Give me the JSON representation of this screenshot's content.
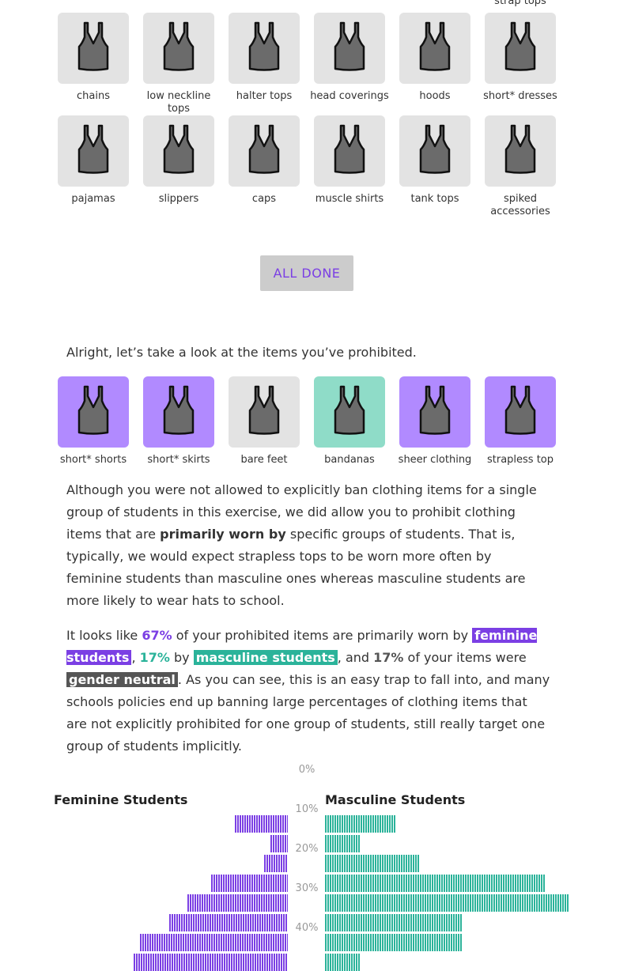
{
  "top_partial_label": "strap tops",
  "selection_grid": [
    {
      "label": "chains"
    },
    {
      "label": "low neckline tops"
    },
    {
      "label": "halter tops"
    },
    {
      "label": "head coverings"
    },
    {
      "label": "hoods"
    },
    {
      "label": "short* dresses"
    },
    {
      "label": "pajamas"
    },
    {
      "label": "slippers"
    },
    {
      "label": "caps"
    },
    {
      "label": "muscle shirts"
    },
    {
      "label": "tank tops"
    },
    {
      "label": "spiked accessories"
    }
  ],
  "done_button": "ALL DONE",
  "intro_text": "Alright, let’s take a look at the items you’ve prohibited.",
  "prohibited_items": [
    {
      "label": "short* shorts",
      "group": "feminine"
    },
    {
      "label": "short* skirts",
      "group": "feminine"
    },
    {
      "label": "bare feet",
      "group": "neutral"
    },
    {
      "label": "bandanas",
      "group": "masculine"
    },
    {
      "label": "sheer clothing",
      "group": "feminine"
    },
    {
      "label": "strapless top",
      "group": "feminine"
    }
  ],
  "explanation": {
    "part1": "Although you were not allowed to explicitly ban clothing items for a single group of students in this exercise, we did allow you to prohibit clothing items that are ",
    "bold": "primarily worn by",
    "part2": " specific groups of students. That is, typically, we would expect strapless tops to be worn more often by feminine students than masculine ones whereas masculine students are more likely to wear hats to school."
  },
  "summary": {
    "s1": "It looks like ",
    "fem_pct": "67%",
    "s2": " of your prohibited items are primarily worn by ",
    "fem_label": "feminine students",
    "s3": ", ",
    "masc_pct": "17%",
    "s4": " by ",
    "masc_label": "masculine students",
    "s5": ", and ",
    "neutral_pct": "17%",
    "s6": " of your items were ",
    "neutral_label": "gender neutral",
    "s7": ". As you can see, this is an easy trap to fall into, and many schools policies end up banning large percentages of clothing items that are not explicitly prohibited for one group of students, still really target one group of students implicitly."
  },
  "colors": {
    "feminine": "#7b3fe4",
    "masculine": "#2bb39a",
    "neutral": "#555555"
  },
  "chart_data": {
    "type": "bar",
    "orientation": "horizontal-back-to-back",
    "left_title": "Feminine Students",
    "right_title": "Masculine Students",
    "ticks": [
      "0%",
      "10%",
      "20%",
      "30%",
      "40%"
    ],
    "max_units": 50,
    "series": [
      {
        "name": "Feminine Students",
        "values": [
          9,
          3,
          4,
          13,
          17,
          20,
          25,
          26
        ]
      },
      {
        "name": "Masculine Students",
        "values": [
          12,
          6,
          16,
          37,
          41,
          23,
          23,
          6
        ]
      }
    ]
  }
}
